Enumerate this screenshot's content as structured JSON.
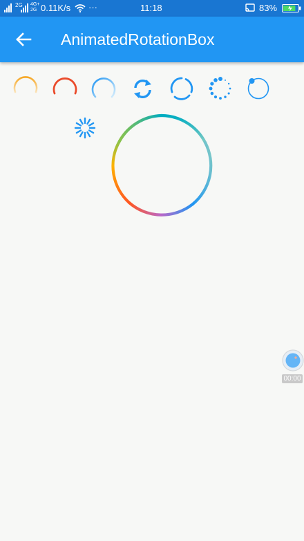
{
  "status_bar": {
    "signal_1": "2G",
    "signal_2": "4G+ 2G",
    "network_speed": "0.11K/s",
    "more": "···",
    "time": "11:18",
    "battery": "83%",
    "battery_level": 0.83
  },
  "app_bar": {
    "title": "AnimatedRotationBox",
    "back_icon": "arrow-left-icon"
  },
  "loaders": [
    {
      "name": "orange-gradient-arc-spinner",
      "colors": [
        "#f6a623",
        "#fbd9a0"
      ]
    },
    {
      "name": "red-arc-spinner",
      "colors": [
        "#ea4b2b"
      ]
    },
    {
      "name": "blue-fading-arc-spinner",
      "colors": [
        "#2196f3",
        "#bfe3fb"
      ]
    },
    {
      "name": "refresh-icon",
      "colors": [
        "#2196f3"
      ]
    },
    {
      "name": "double-arc-spinner",
      "colors": [
        "#2196f3"
      ]
    },
    {
      "name": "dot-circle-spinner",
      "colors": [
        "#2196f3"
      ]
    },
    {
      "name": "orbit-dot-spinner",
      "colors": [
        "#2196f3"
      ]
    },
    {
      "name": "sunburst-spinner",
      "colors": [
        "#2196f3"
      ]
    }
  ],
  "big_ring": {
    "name": "multicolor-ring",
    "colors": [
      "#00acc1",
      "#80cbc4",
      "#2196f3",
      "#ba68c8",
      "#ff5722",
      "#ffb300",
      "#8bc34a"
    ]
  },
  "floating_widget": {
    "time": "00:00",
    "accent": "#64b5f6"
  }
}
